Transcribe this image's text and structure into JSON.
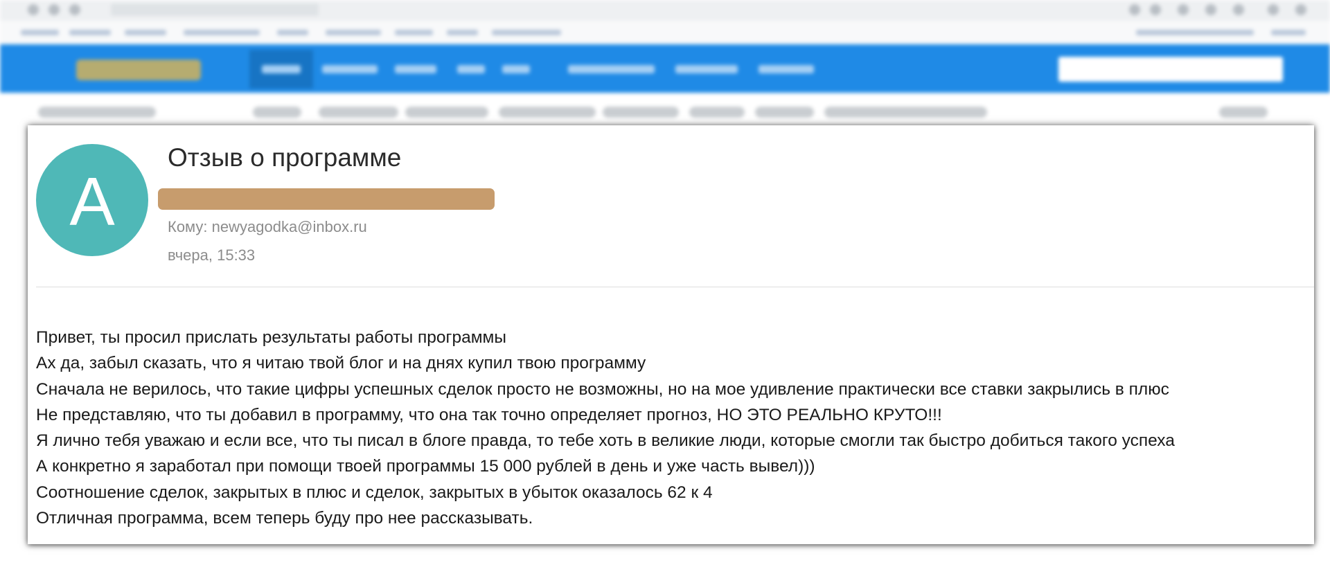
{
  "email": {
    "avatar_letter": "A",
    "subject": "Отзыв о программе",
    "recipient": "Кому: newyagodka@inbox.ru",
    "date": "вчера, 15:33",
    "body_lines": [
      "Привет, ты просил прислать результаты работы программы",
      "Ах да, забыл сказать, что я читаю твой блог и на днях купил твою программу",
      "Сначала не верилось, что такие цифры успешных сделок просто не возможны, но на мое удивление практически все ставки закрылись в плюс",
      "Не представляю, что ты добавил в программу, что она так точно определяет прогноз, НО ЭТО РЕАЛЬНО КРУТО!!!",
      "Я лично тебя уважаю и если все, что ты писал в блоге правда, то тебе хоть в великие люди, которые смогли так быстро добиться такого успеха",
      "А конкретно я заработал при помощи твоей программы 15 000 рублей в день и уже часть вывел)))",
      "Соотношение сделок, закрытых в плюс и сделок, закрытых в убыток оказалось 62 к 4",
      "Отличная программа, всем теперь буду про нее рассказывать."
    ]
  },
  "colors": {
    "avatar": "#4fb8b7",
    "redaction": "#c79c6d",
    "nav_bar": "#1f8ae6",
    "muted_text": "#8c8c8c"
  }
}
